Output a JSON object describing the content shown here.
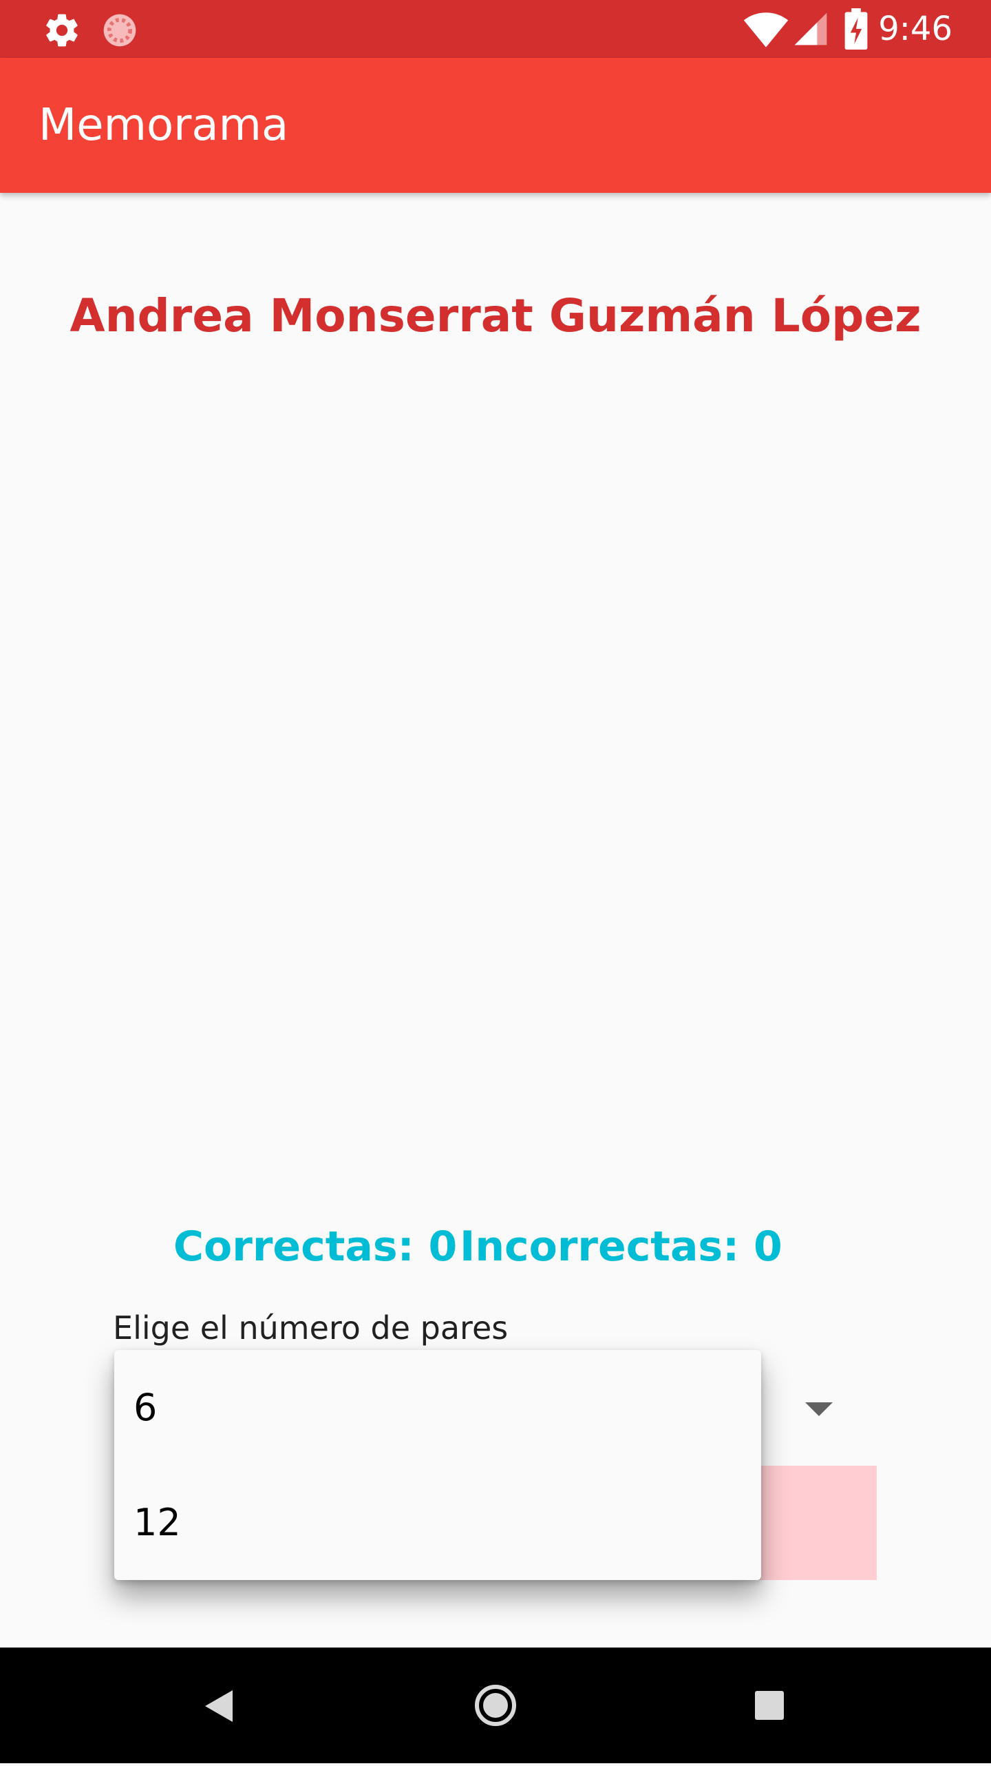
{
  "status_bar": {
    "time": "9:46",
    "background": "#d32f2f",
    "icons": [
      "gear-icon",
      "sync-icon",
      "wifi-icon",
      "signal-icon",
      "battery-charging-icon"
    ]
  },
  "app_bar": {
    "title": "Memorama",
    "background": "#f44336"
  },
  "content": {
    "player_name": "Andrea Monserrat Guzmán López",
    "scores": {
      "correct": "Correctas: 0",
      "incorrect": "Incorrectas: 0"
    },
    "pairs_prompt": "Elige el número de pares"
  },
  "dropdown": {
    "options": [
      "6",
      "12"
    ]
  },
  "nav_bar": {
    "icons": [
      "back-icon",
      "home-icon",
      "recents-icon"
    ]
  },
  "colors": {
    "accent_red": "#d32f2f",
    "score_cyan": "#00bcd4",
    "button_pink": "#ffcdd2"
  }
}
